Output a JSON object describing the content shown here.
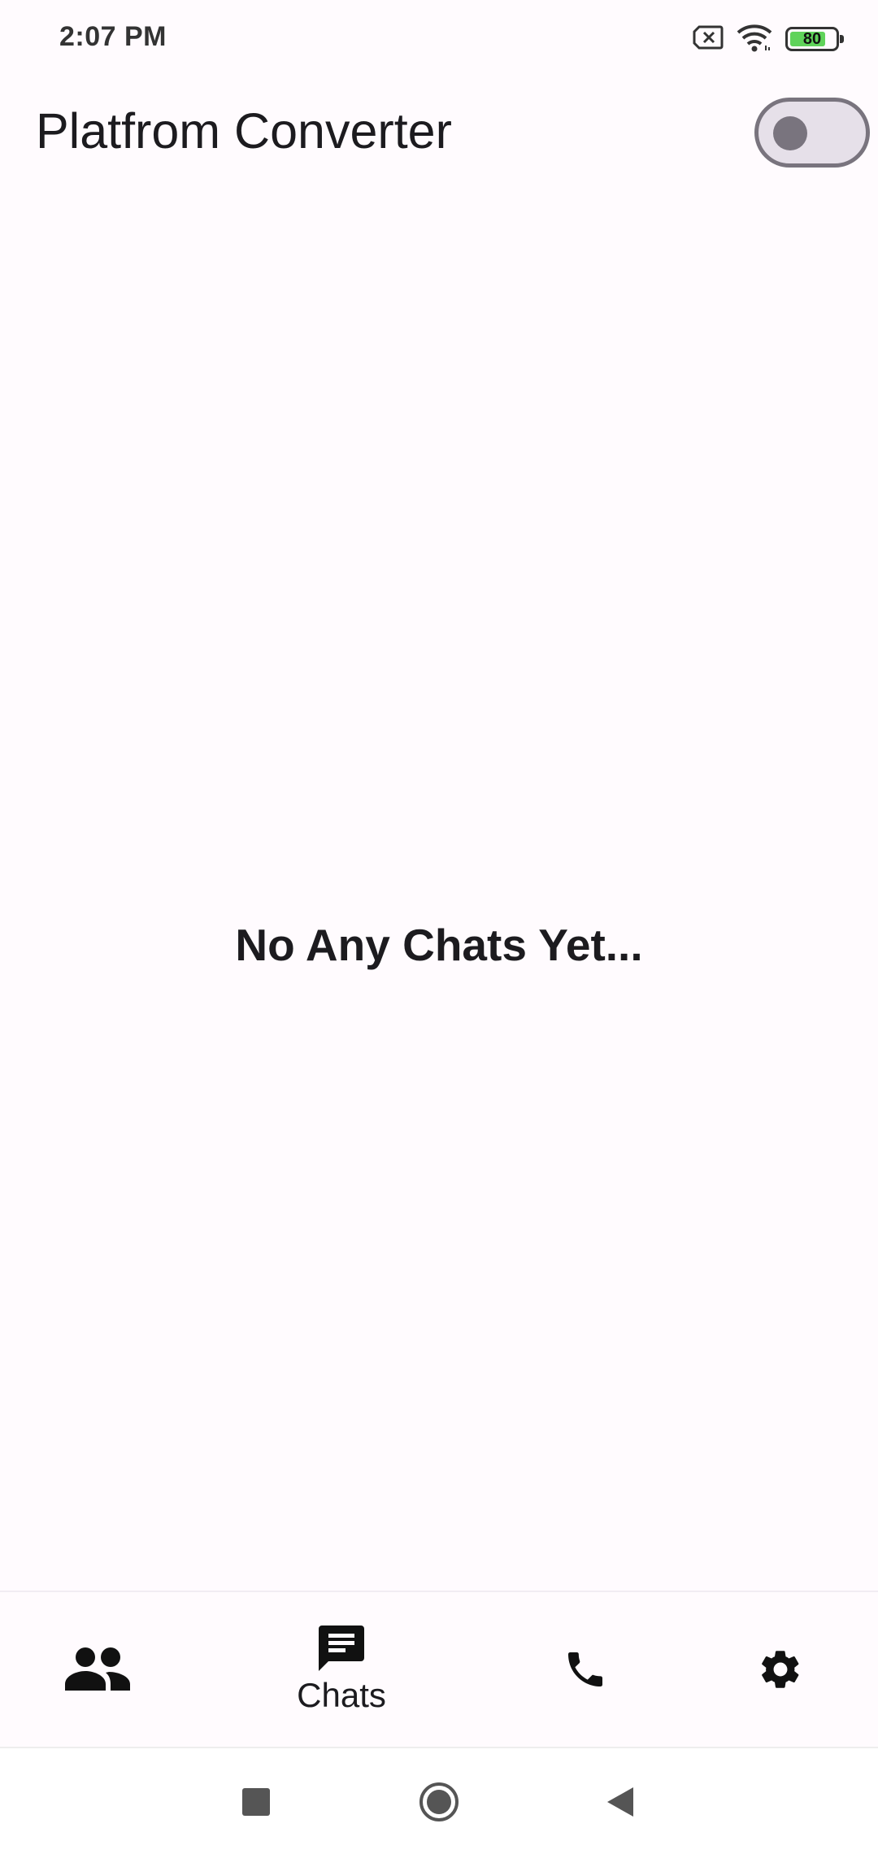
{
  "status_bar": {
    "time": "2:07 PM",
    "battery_level": "80",
    "battery_fraction": 0.8,
    "icons": [
      "sim-card-x-icon",
      "wifi-icon",
      "battery-icon"
    ]
  },
  "app_bar": {
    "title": "Platfrom Converter",
    "theme_switch_on": false
  },
  "main": {
    "empty_message": "No Any Chats Yet..."
  },
  "bottom_nav": {
    "items": [
      {
        "icon": "people-icon",
        "label": "",
        "selected": false
      },
      {
        "icon": "chat-icon",
        "label": "Chats",
        "selected": true
      },
      {
        "icon": "phone-icon",
        "label": "",
        "selected": false
      },
      {
        "icon": "settings-icon",
        "label": "",
        "selected": false
      }
    ]
  },
  "system_nav": {
    "buttons": [
      "recents-square-icon",
      "home-circle-icon",
      "back-triangle-icon"
    ]
  },
  "colors": {
    "background": "#fffbfe",
    "text": "#1c1b1f",
    "switch_track": "#e6e0e9",
    "switch_outline": "#79747e",
    "battery_fill": "#5fd35a"
  }
}
